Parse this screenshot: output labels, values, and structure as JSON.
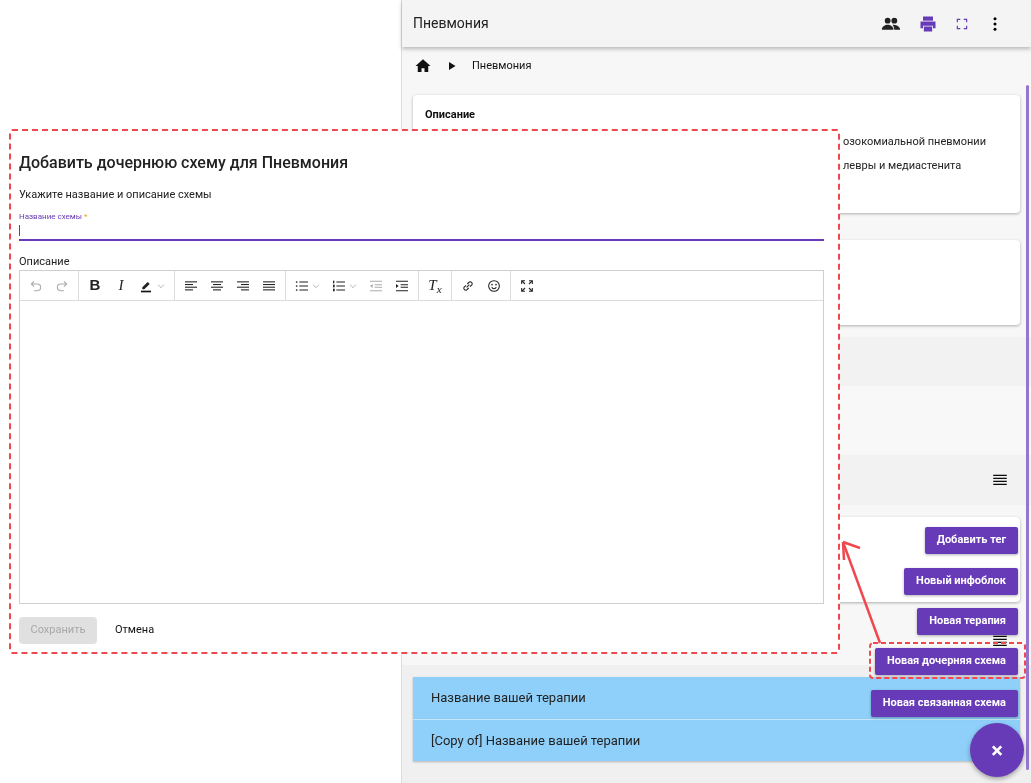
{
  "header": {
    "title": "Пневмония"
  },
  "breadcrumb": {
    "current": "Пневмония"
  },
  "description_card": {
    "title": "Описание",
    "lines": [
      "озокомиальной пневмонии",
      "левры и медиастенита"
    ]
  },
  "dialog": {
    "title": "Добавить дочернюю схему для Пневмония",
    "subtitle": "Укажите название и описание схемы",
    "name_field": {
      "label": "Название схемы",
      "required_mark": "*",
      "focused": true
    },
    "description_label": "Описание",
    "toolbar": [
      [
        {
          "kind": "undo",
          "disabled": true,
          "dropdown": false
        },
        {
          "kind": "redo",
          "disabled": true,
          "dropdown": false
        }
      ],
      [
        {
          "kind": "bold",
          "label": "B",
          "disabled": false,
          "dropdown": false
        },
        {
          "kind": "italic",
          "label": "I",
          "disabled": false,
          "dropdown": false
        },
        {
          "kind": "highlight",
          "disabled": false,
          "dropdown": true
        }
      ],
      [
        {
          "kind": "align-left",
          "disabled": false,
          "dropdown": false
        },
        {
          "kind": "align-center",
          "disabled": false,
          "dropdown": false
        },
        {
          "kind": "align-right",
          "disabled": false,
          "dropdown": false
        },
        {
          "kind": "justify",
          "disabled": false,
          "dropdown": false
        }
      ],
      [
        {
          "kind": "bullets",
          "disabled": false,
          "dropdown": true
        },
        {
          "kind": "numbered",
          "disabled": false,
          "dropdown": true
        },
        {
          "kind": "outdent",
          "disabled": true,
          "dropdown": false
        },
        {
          "kind": "indent",
          "disabled": false,
          "dropdown": false
        }
      ],
      [
        {
          "kind": "clear-format",
          "label": "T$_{x}$",
          "disabled": false,
          "dropdown": false
        }
      ],
      [
        {
          "kind": "link",
          "disabled": false,
          "dropdown": false
        },
        {
          "kind": "emoji",
          "disabled": false,
          "dropdown": false
        }
      ],
      [
        {
          "kind": "fullscreen",
          "disabled": false,
          "dropdown": false
        }
      ]
    ],
    "buttons": [
      {
        "label": "Сохранить",
        "kind": "primary",
        "disabled": true
      },
      {
        "label": "Отмена",
        "kind": "text",
        "disabled": false
      }
    ]
  },
  "fab_menu": {
    "actions": [
      "Добавить тег",
      "Новый инфоблок",
      "Новая терапия",
      "Новая дочерняя схема",
      "Новая связанная схема"
    ],
    "close": "×"
  },
  "therapies": [
    "Название вашей терапии",
    "[Copy of] Название вашей терапии"
  ]
}
